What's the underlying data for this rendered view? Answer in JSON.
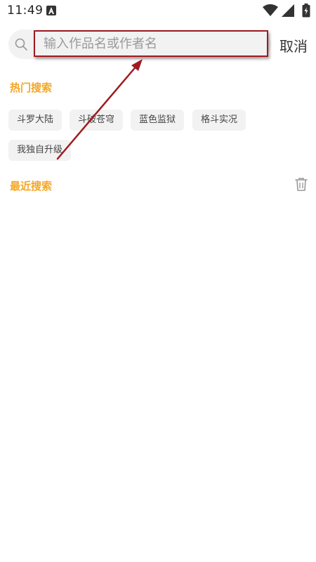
{
  "status_bar": {
    "time": "11:49",
    "app_icon": "font-a-icon",
    "wifi_icon": "wifi-icon",
    "signal_icon": "signal-icon",
    "battery_icon": "battery-charging-icon"
  },
  "search": {
    "placeholder": "输入作品名或作者名",
    "value": "",
    "icon": "search-icon",
    "cancel_label": "取消"
  },
  "hot_search": {
    "title": "热门搜索",
    "tags": [
      "斗罗大陆",
      "斗破苍穹",
      "蓝色监狱",
      "格斗实况",
      "我独自升级"
    ]
  },
  "recent_search": {
    "title": "最近搜索",
    "clear_icon": "trash-icon",
    "items": []
  },
  "colors": {
    "accent": "#f5a623",
    "annotation": "#a01a20",
    "chip_bg": "#f2f2f2"
  }
}
